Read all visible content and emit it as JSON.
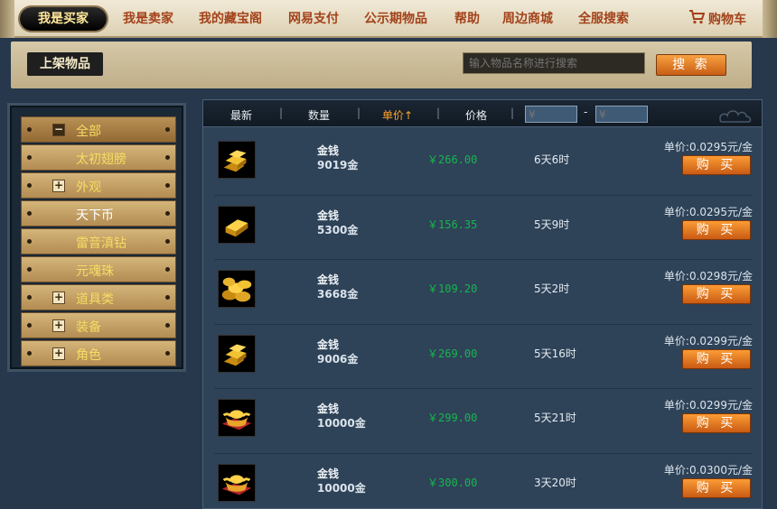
{
  "topnav": {
    "active": "我是买家",
    "items": [
      "我是卖家",
      "我的藏宝阁",
      "网易支付",
      "公示期物品",
      "帮助",
      "周边商城",
      "全服搜索"
    ],
    "cart": "购物车"
  },
  "subbar": {
    "title": "上架物品",
    "search_placeholder": "输入物品名称进行搜索",
    "search_button": "搜 索"
  },
  "sidebar": {
    "items": [
      {
        "label": "全部",
        "icon": "minus"
      },
      {
        "label": "太初翅膀",
        "icon": ""
      },
      {
        "label": "外观",
        "icon": "plus"
      },
      {
        "label": "天下币",
        "icon": ""
      },
      {
        "label": "雷音滇钻",
        "icon": ""
      },
      {
        "label": "元魂珠",
        "icon": ""
      },
      {
        "label": "道具类",
        "icon": "plus"
      },
      {
        "label": "装备",
        "icon": "plus"
      },
      {
        "label": "角色",
        "icon": "plus"
      }
    ]
  },
  "filter": {
    "newest": "最新",
    "quantity": "数量",
    "unit_price": "单价↑",
    "price": "价格",
    "min_placeholder": "¥",
    "max_placeholder": "¥",
    "dash": "-"
  },
  "listings": [
    {
      "name": "金钱",
      "amount": "9019金",
      "price": "￥266.00",
      "time": "6天6时",
      "unit": "单价:0.0295元/金",
      "icon": "gold-bars-icon",
      "buy": "购 买"
    },
    {
      "name": "金钱",
      "amount": "5300金",
      "price": "￥156.35",
      "time": "5天9时",
      "unit": "单价:0.0295元/金",
      "icon": "gold-bar-icon",
      "buy": "购 买"
    },
    {
      "name": "金钱",
      "amount": "3668金",
      "price": "￥109.20",
      "time": "5天2时",
      "unit": "单价:0.0298元/金",
      "icon": "gold-coins-icon",
      "buy": "购 买"
    },
    {
      "name": "金钱",
      "amount": "9006金",
      "price": "￥269.00",
      "time": "5天16时",
      "unit": "单价:0.0299元/金",
      "icon": "gold-bars-icon",
      "buy": "购 买"
    },
    {
      "name": "金钱",
      "amount": "10000金",
      "price": "￥299.00",
      "time": "5天21时",
      "unit": "单价:0.0299元/金",
      "icon": "gold-ingot-icon",
      "buy": "购 买"
    },
    {
      "name": "金钱",
      "amount": "10000金",
      "price": "￥300.00",
      "time": "3天20时",
      "unit": "单价:0.0300元/金",
      "icon": "gold-ingot-icon",
      "buy": "购 买"
    }
  ]
}
